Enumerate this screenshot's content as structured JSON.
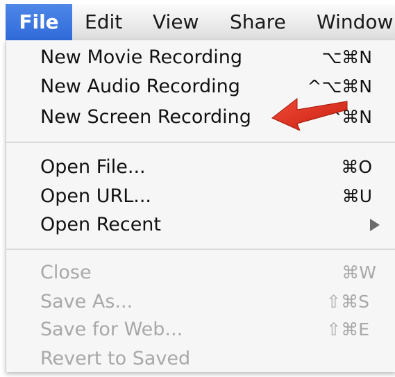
{
  "menubar": {
    "items": [
      "File",
      "Edit",
      "View",
      "Share",
      "Window"
    ]
  },
  "menu": {
    "group1": [
      {
        "label": "New Movie Recording",
        "shortcut": "⌥⌘N"
      },
      {
        "label": "New Audio Recording",
        "shortcut": "^⌥⌘N"
      },
      {
        "label": "New Screen Recording",
        "shortcut": "^⌘N"
      }
    ],
    "group2": [
      {
        "label": "Open File...",
        "shortcut": "⌘O"
      },
      {
        "label": "Open URL...",
        "shortcut": "⌘U"
      },
      {
        "label": "Open Recent",
        "submenu_icon": "triangle-right-icon"
      }
    ],
    "group3": [
      {
        "label": "Close",
        "shortcut": "⌘W",
        "enabled": false
      },
      {
        "label": "Save As...",
        "shortcut": "⇧⌘S",
        "enabled": false
      },
      {
        "label": "Save for Web...",
        "shortcut": "⇧⌘E",
        "enabled": false
      },
      {
        "label": "Revert to Saved",
        "enabled": false
      }
    ]
  },
  "annotation": {
    "icon": "red-arrow-icon",
    "color": "#e8321f"
  },
  "colors": {
    "menubar_active": "#3b74df",
    "menu_bg": "#f6f6f6",
    "disabled_text": "#a8a8a8"
  }
}
